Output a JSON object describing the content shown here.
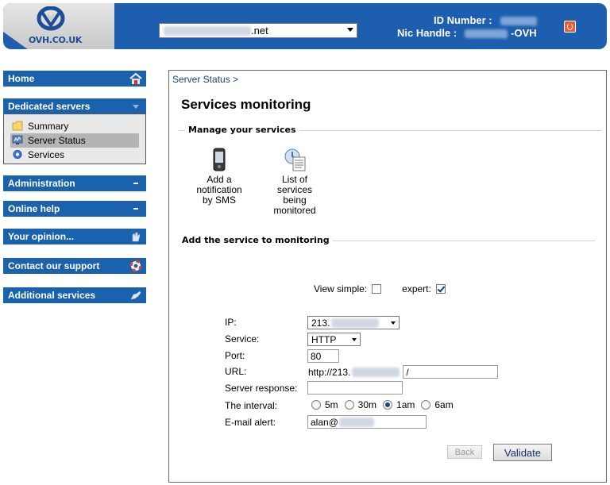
{
  "header": {
    "logo_text": "OVH.CO.UK",
    "domain_select": {
      "suffix": ".net"
    },
    "id_number_label": "ID Number :",
    "nic_handle_label": "Nic Handle :",
    "nic_handle_suffix": "-OVH",
    "logout_icon": "power-icon"
  },
  "sidebar": {
    "home": "Home",
    "dedicated_servers": "Dedicated servers",
    "items": [
      {
        "label": "Summary",
        "icon": "folder-icon"
      },
      {
        "label": "Server Status",
        "icon": "monitor-icon"
      },
      {
        "label": "Services",
        "icon": "gear-icon"
      }
    ],
    "administration": "Administration",
    "online_help": "Online help",
    "your_opinion": "Your opinion...",
    "contact_support": "Contact our support",
    "additional_services": "Additional services"
  },
  "main": {
    "breadcrumb": "Server Status >",
    "title": "Services monitoring",
    "manage_section": "Manage your services",
    "tiles": [
      {
        "label_lines": [
          "Add a",
          "notification",
          "by SMS"
        ],
        "icon": "phone-icon"
      },
      {
        "label_lines": [
          "List of",
          "services",
          "being",
          "monitored"
        ],
        "icon": "document-list-icon"
      }
    ],
    "add_section": "Add the service to monitoring",
    "view_simple_label": "View simple:",
    "expert_label": "expert:",
    "expert_checked": true,
    "simple_checked": false,
    "form": {
      "ip_label": "IP:",
      "ip_value_prefix": "213.",
      "service_label": "Service:",
      "service_value": "HTTP",
      "port_label": "Port:",
      "port_value": "80",
      "url_label": "URL:",
      "url_prefix": "http://213.",
      "url_path_value": "/",
      "server_response_label": "Server response:",
      "server_response_value": "",
      "interval_label": "The interval:",
      "interval_options": [
        "5m",
        "30m",
        "1am",
        "6am"
      ],
      "interval_selected": "1am",
      "email_label": "E-mail alert:",
      "email_value_prefix": "alan@"
    },
    "back_button": "Back",
    "validate_button": "Validate"
  },
  "colors": {
    "header_blue": "#1d5fae",
    "sidebar_blue": "#1a62ae",
    "link_blue": "#1d3e8a"
  }
}
